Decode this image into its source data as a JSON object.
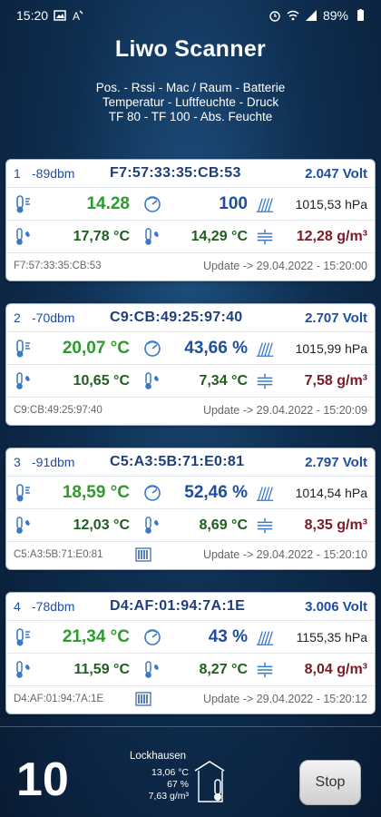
{
  "status_bar": {
    "time": "15:20",
    "battery": "89%"
  },
  "app": {
    "title": "Liwo Scanner",
    "legend": [
      "Pos. - Rssi - Mac / Raum - Batterie",
      "Temperatur - Luftfeuchte - Druck",
      "TF 80 - TF 100 - Abs. Feuchte"
    ]
  },
  "cards": [
    {
      "pos": "1",
      "rssi": "-89dbm",
      "mac": "F7:57:33:35:CB:53",
      "volt": "2.047 Volt",
      "temp": "14.28",
      "hum": "100",
      "pressure": "1015,53 hPa",
      "tf80": "17,78 °C",
      "tf100": "14,29 °C",
      "abs": "12,28 g/m³",
      "mac_small": "F7:57:33:35:CB:53",
      "update": "Update -> 29.04.2022 - 15:20:00",
      "battery_icon": false
    },
    {
      "pos": "2",
      "rssi": "-70dbm",
      "mac": "C9:CB:49:25:97:40",
      "volt": "2.707 Volt",
      "temp": "20,07 °C",
      "hum": "43,66 %",
      "pressure": "1015,99 hPa",
      "tf80": "10,65 °C",
      "tf100": "7,34 °C",
      "abs": "7,58 g/m³",
      "mac_small": "C9:CB:49:25:97:40",
      "update": "Update -> 29.04.2022 - 15:20:09",
      "battery_icon": false
    },
    {
      "pos": "3",
      "rssi": "-91dbm",
      "mac": "C5:A3:5B:71:E0:81",
      "volt": "2.797 Volt",
      "temp": "18,59 °C",
      "hum": "52,46 %",
      "pressure": "1014,54 hPa",
      "tf80": "12,03 °C",
      "tf100": "8,69 °C",
      "abs": "8,35 g/m³",
      "mac_small": "C5:A3:5B:71:E0:81",
      "update": "Update -> 29.04.2022 - 15:20:10",
      "battery_icon": true
    },
    {
      "pos": "4",
      "rssi": "-78dbm",
      "mac": "D4:AF:01:94:7A:1E",
      "volt": "3.006 Volt",
      "temp": "21,34 °C",
      "hum": "43 %",
      "pressure": "1155,35 hPa",
      "tf80": "11,59 °C",
      "tf100": "8,27 °C",
      "abs": "8,04 g/m³",
      "mac_small": "D4:AF:01:94:7A:1E",
      "update": "Update -> 29.04.2022 - 15:20:12",
      "battery_icon": true
    }
  ],
  "footer": {
    "count": "10",
    "station_name": "Lockhausen",
    "station_temp": "13,06 °C",
    "station_hum": "67 %",
    "station_abs": "7,63 g/m³",
    "stop_label": "Stop"
  },
  "colors": {
    "value_green": "#2f9a2f",
    "value_darkgreen": "#1e5f1e",
    "value_blue": "#1e4da1",
    "value_maroon": "#7a1a24"
  }
}
